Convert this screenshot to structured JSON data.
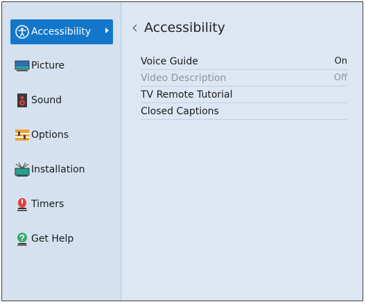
{
  "sidebar": {
    "items": [
      {
        "label": "Accessibility",
        "icon": "accessibility-icon",
        "active": true
      },
      {
        "label": "Picture",
        "icon": "picture-icon",
        "active": false
      },
      {
        "label": "Sound",
        "icon": "speaker-icon",
        "active": false
      },
      {
        "label": "Options",
        "icon": "options-icon",
        "active": false
      },
      {
        "label": "Installation",
        "icon": "antenna-icon",
        "active": false
      },
      {
        "label": "Timers",
        "icon": "timer-icon",
        "active": false
      },
      {
        "label": "Get Help",
        "icon": "help-icon",
        "active": false
      }
    ]
  },
  "content": {
    "title": "Accessibility",
    "items": [
      {
        "label": "Voice Guide",
        "value": "On",
        "disabled": false
      },
      {
        "label": "Video Description",
        "value": "Off",
        "disabled": true
      },
      {
        "label": "TV Remote Tutorial",
        "value": "",
        "disabled": false
      },
      {
        "label": "Closed Captions",
        "value": "",
        "disabled": false
      }
    ]
  },
  "colors": {
    "active_item": "#1476c9",
    "sidebar_bg": "#d6e1ef",
    "content_bg": "#dde7f3",
    "disabled_text": "#8d939b"
  }
}
